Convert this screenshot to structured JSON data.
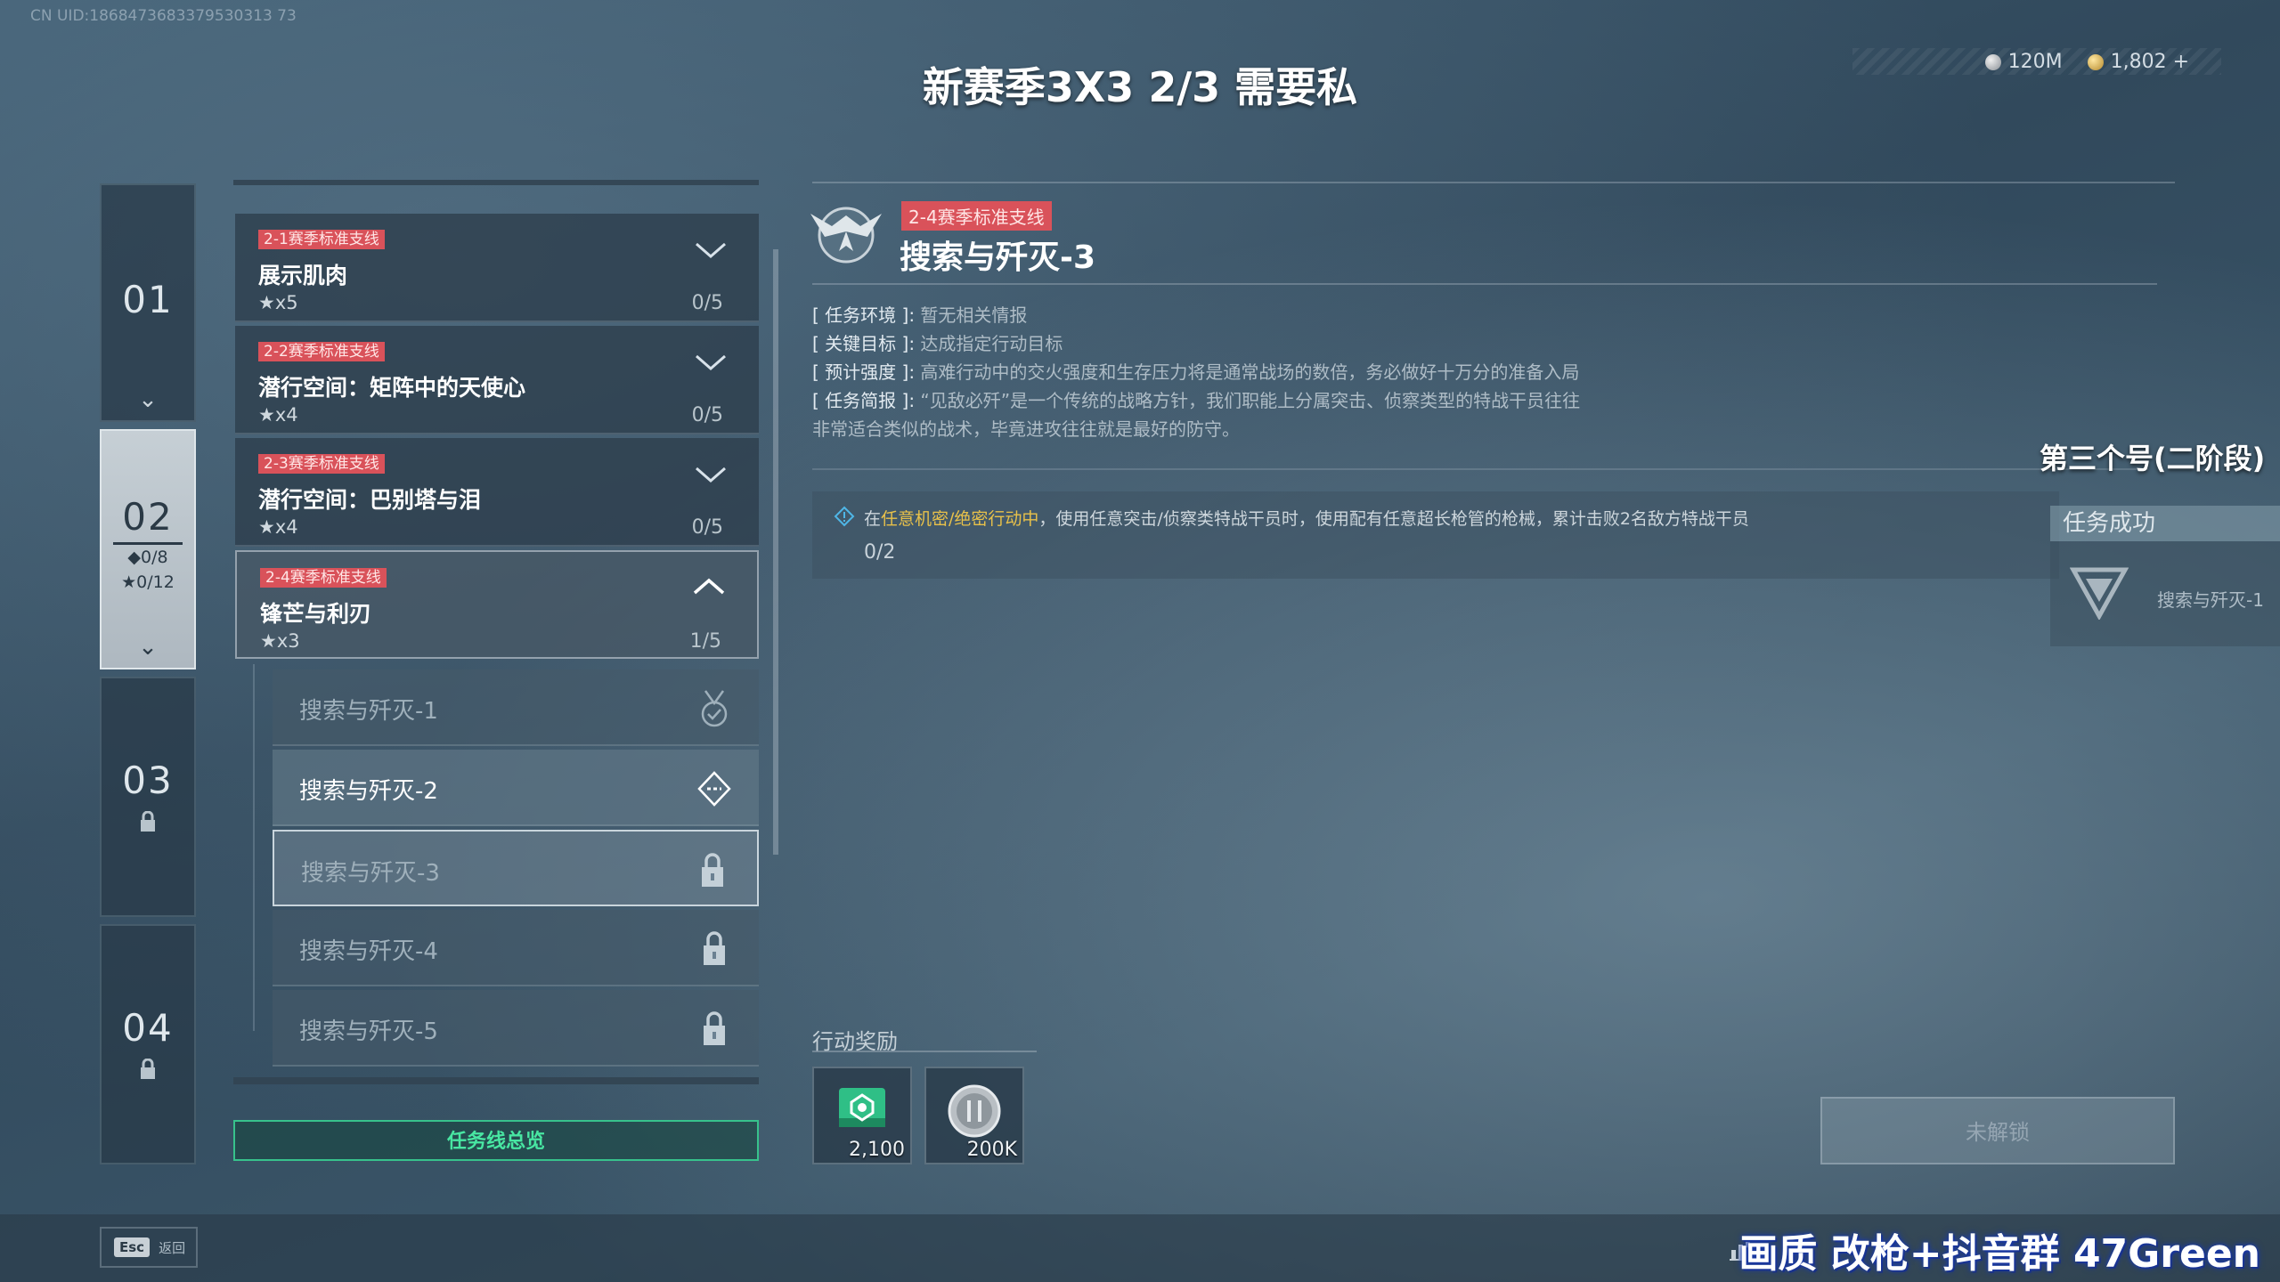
{
  "header": {
    "uid": "CN UID:1868473683379530313 73",
    "title": "新赛季3X3  2/3  需要私"
  },
  "currency": {
    "silver": "120M",
    "gold": "1,802",
    "add": "+"
  },
  "chapters": [
    {
      "num": "01",
      "chev": "⌄"
    },
    {
      "num": "02",
      "diamond": "◆0/8",
      "star": "★0/12",
      "chev": "⌄"
    },
    {
      "num": "03",
      "lock": "🔒"
    },
    {
      "num": "04",
      "lock": "🔒"
    }
  ],
  "missions": [
    {
      "tag": "2-1赛季标准支线",
      "name": "展示肌肉",
      "stars": "★x5",
      "progress": "0/5"
    },
    {
      "tag": "2-2赛季标准支线",
      "name": "潜行空间：矩阵中的天使心",
      "stars": "★x4",
      "progress": "0/5"
    },
    {
      "tag": "2-3赛季标准支线",
      "name": "潜行空间：巴别塔与泪",
      "stars": "★x4",
      "progress": "0/5"
    },
    {
      "tag": "2-4赛季标准支线",
      "name": "锋芒与利刃",
      "stars": "★x3",
      "progress": "1/5"
    }
  ],
  "submissions": [
    {
      "name": "搜索与歼灭-1",
      "state": "done"
    },
    {
      "name": "搜索与歼灭-2",
      "state": "current"
    },
    {
      "name": "搜索与歼灭-3",
      "state": "locked"
    },
    {
      "name": "搜索与歼灭-4",
      "state": "locked"
    },
    {
      "name": "搜索与歼灭-5",
      "state": "locked"
    }
  ],
  "overview_button": "任务线总览",
  "detail": {
    "tag": "2-4赛季标准支线",
    "title": "搜索与歼灭-3",
    "env_key": "[ 任务环境 ]:",
    "env_val": "暂无相关情报",
    "goal_key": "[ 关键目标 ]:",
    "goal_val": "达成指定行动目标",
    "intensity_key": "[ 预计强度 ]:",
    "intensity_val": "高难行动中的交火强度和生存压力将是通常战场的数倍，务必做好十万分的准备入局",
    "brief_key": "[ 任务简报 ]:",
    "brief_val": "“见敌必歼”是一个传统的战略方针，我们职能上分属突击、侦察类型的特战干员往往",
    "brief_cont": "非常适合类似的战术，毕竟进攻往往就是最好的防守。",
    "objective_pre": "在",
    "objective_hl": "任意机密/绝密行动中",
    "objective_post": "，使用任意突击/侦察类特战干员时，使用配有任意超长枪管的枪械，累计击败2名敌方特战干员",
    "objective_progress": "0/2"
  },
  "overlay": {
    "stage_label": "第三个号(二阶段)",
    "success_title": "任务成功",
    "success_item": "搜索与歼灭-1"
  },
  "rewards": {
    "label": "行动奖励",
    "items": [
      {
        "icon": "green-crate-icon",
        "amount": "2,100"
      },
      {
        "icon": "silver-coin-icon",
        "amount": "200K"
      }
    ]
  },
  "unlock_button": "未解锁",
  "bottom": {
    "esc_key": "Esc",
    "esc_label": "返回",
    "watermark": "画质 改枪+抖音群 47Green"
  },
  "colors": {
    "tag": "#d9525a",
    "accent_green": "#37c28c",
    "highlight": "#e8c14a"
  }
}
